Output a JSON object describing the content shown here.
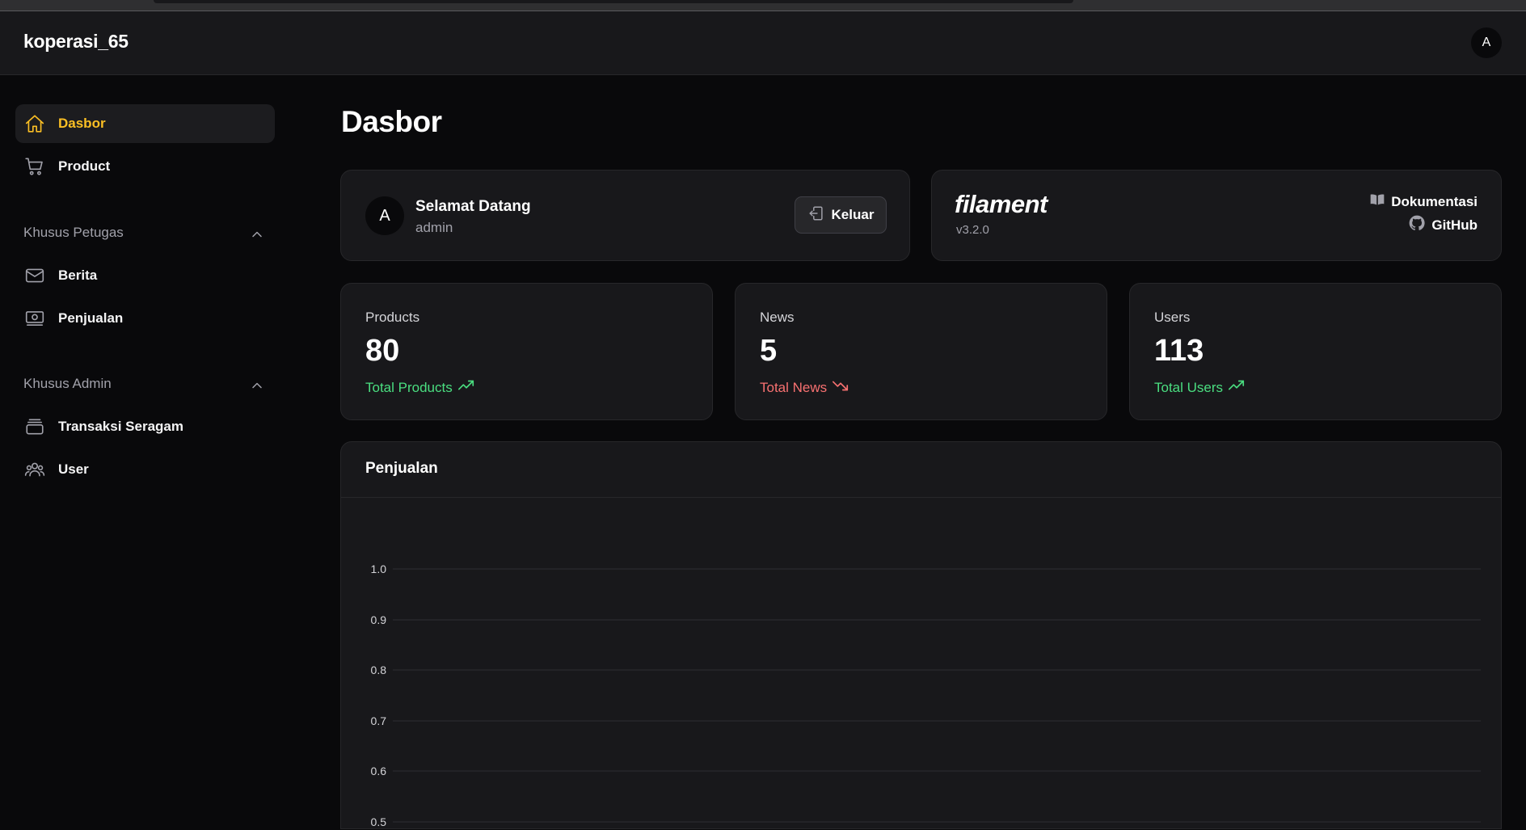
{
  "app": {
    "brand": "koperasi_65",
    "user_initial": "A"
  },
  "sidebar": {
    "items": [
      {
        "label": "Dasbor",
        "icon": "home-icon",
        "active": true
      },
      {
        "label": "Product",
        "icon": "cart-icon"
      }
    ],
    "groups": [
      {
        "label": "Khusus Petugas",
        "items": [
          {
            "label": "Berita",
            "icon": "envelope-icon"
          },
          {
            "label": "Penjualan",
            "icon": "banknotes-icon"
          }
        ]
      },
      {
        "label": "Khusus Admin",
        "items": [
          {
            "label": "Transaksi Seragam",
            "icon": "inbox-stack-icon"
          },
          {
            "label": "User",
            "icon": "users-icon"
          }
        ]
      }
    ]
  },
  "page": {
    "title": "Dasbor"
  },
  "welcome": {
    "avatar_initial": "A",
    "title": "Selamat Datang",
    "username": "admin",
    "logout_label": "Keluar"
  },
  "filament": {
    "logo": "filament",
    "version": "v3.2.0",
    "docs_label": "Dokumentasi",
    "github_label": "GitHub"
  },
  "stats": [
    {
      "label": "Products",
      "value": "80",
      "description": "Total Products",
      "trend": "up",
      "color": "#4ade80"
    },
    {
      "label": "News",
      "value": "5",
      "description": "Total News",
      "trend": "down",
      "color": "#f87171"
    },
    {
      "label": "Users",
      "value": "113",
      "description": "Total Users",
      "trend": "up",
      "color": "#4ade80"
    }
  ],
  "colors": {
    "accent": "#fbbf24",
    "success": "#4ade80",
    "danger": "#f87171"
  },
  "chart_data": {
    "type": "line",
    "title": "Penjualan",
    "xlabel": "",
    "ylabel": "",
    "yticks": [
      "1.0",
      "0.9",
      "0.8",
      "0.7",
      "0.6",
      "0.5"
    ],
    "ylim": [
      0.5,
      1.0
    ],
    "grid": true,
    "series": []
  }
}
